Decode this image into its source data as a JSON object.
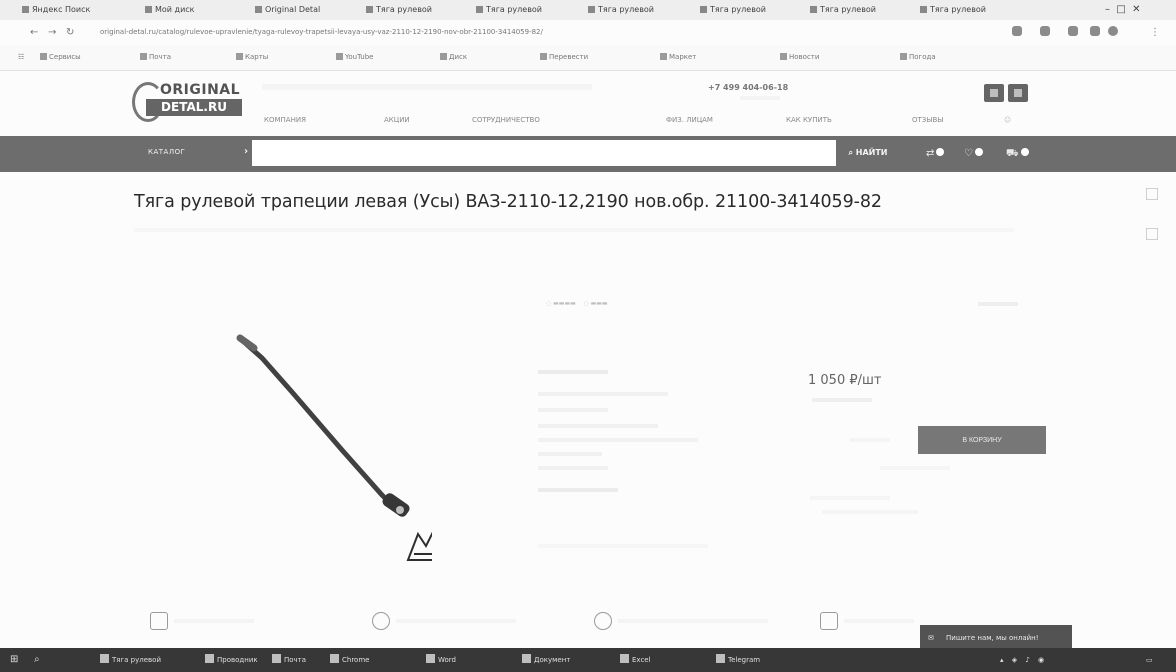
{
  "browser": {
    "tabs": [
      "Яндекс Поиск",
      "Мой диск",
      "Original Detal",
      "Тяга рулевой",
      "Тяга рулевой",
      "Тяга рулевой",
      "Тяга рулевой",
      "Тяга рулевой",
      "Тяга рулевой"
    ],
    "url": "original-detal.ru/catalog/rulevoe-upravlenie/tyaga-rulevoy-trapetsii-levaya-usy-vaz-2110-12-2190-nov-obr-21100-3414059-82/",
    "bookmarks": [
      "Сервисы",
      "Почта",
      "Карты",
      "YouTube",
      "Диск",
      "Перевести",
      "Маркет",
      "Новости",
      "Погода"
    ]
  },
  "header": {
    "logo_top": "ORIGINAL",
    "logo_bottom": "DETAL.RU",
    "phone": "+7 499 404-06-18",
    "menu": [
      "Компания",
      "Акции",
      "Сотрудничество",
      "Физ. лицам",
      "Как купить",
      "Отзывы"
    ]
  },
  "search": {
    "catalog_label": "КАТАЛОГ",
    "placeholder": "",
    "find_label": "НАЙТИ"
  },
  "product": {
    "title": "Тяга рулевой трапеции левая (Усы) ВАЗ-2110-12,2190 нов.обр. 21100-3414059-82",
    "price": "1 050 ₽/шт",
    "cart_label": "В КОРЗИНУ"
  },
  "chat": {
    "label": "Пишите нам, мы онлайн!"
  },
  "taskbar": {
    "items": [
      "Тяга рулевой",
      "Проводник",
      "Почта",
      "Chrome",
      "Word",
      "Документ",
      "Excel",
      "Telegram"
    ]
  }
}
